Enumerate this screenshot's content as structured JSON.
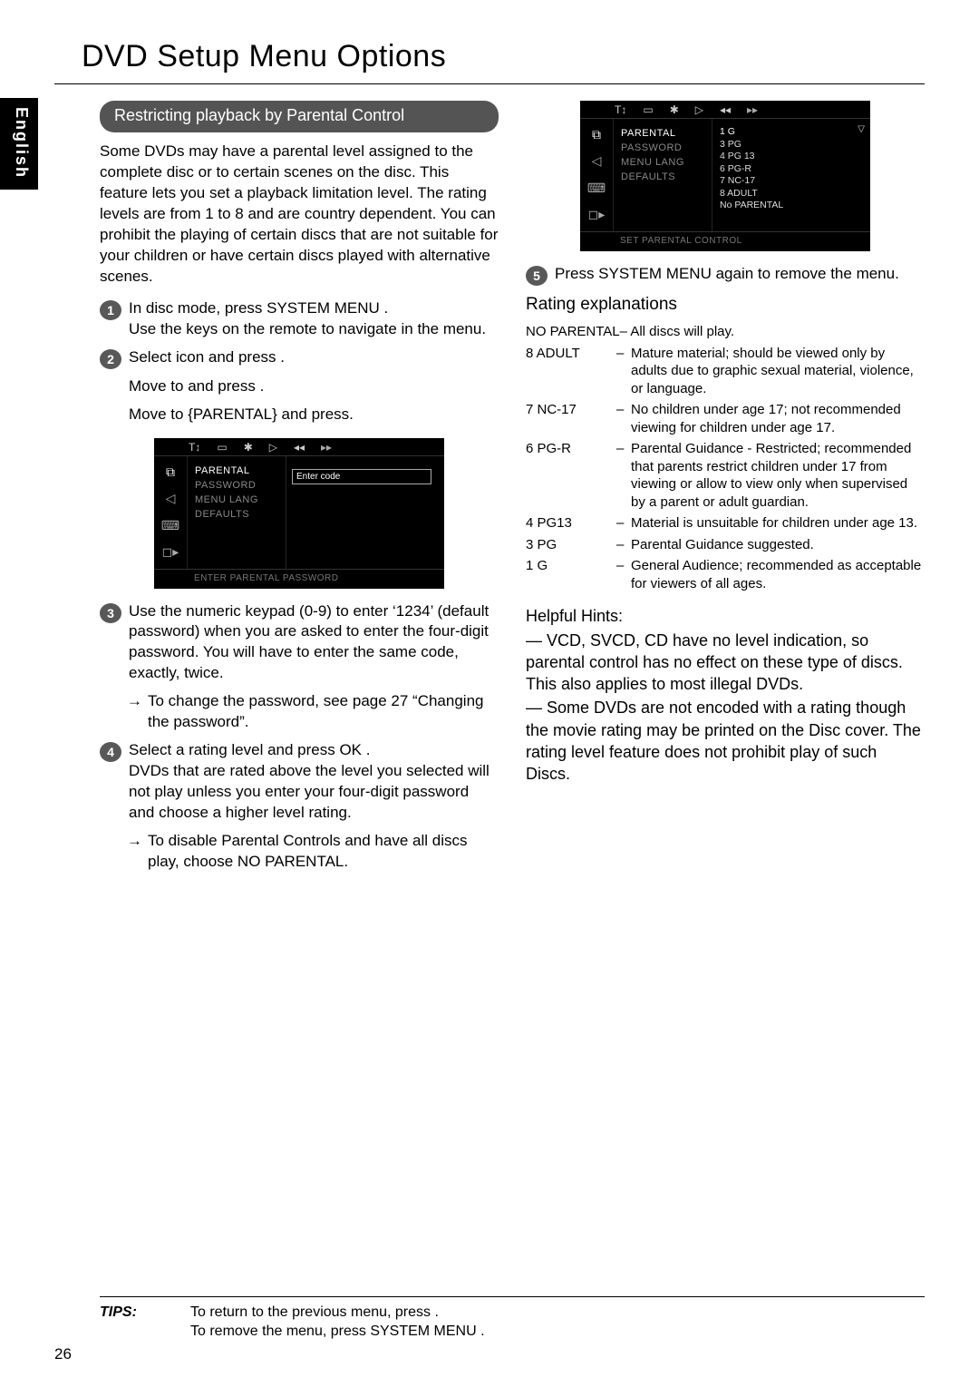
{
  "page_title": "DVD Setup Menu Options",
  "language_tab": "English",
  "section_header": "Restricting playback by Parental Control",
  "intro": "Some DVDs may have a parental level assigned to the complete disc or to certain scenes on the disc. This feature lets you set a playback limitation level. The rating levels are from 1 to 8 and are country dependent. You can prohibit the playing of certain discs that are not suitable for your children or have certain discs played with alternative scenes.",
  "steps": {
    "s1a": "In disc mode, press SYSTEM MENU .",
    "s1b": "Use the            keys on the remote to navigate in the menu.",
    "s2a": "Select     icon and press .",
    "s2b": "Move to       and press .",
    "s2c": "Move to {PARENTAL} and press.",
    "s3a": "Use the numeric keypad (0-9)  to enter ‘1234’ (default password) when you are asked to enter the four-digit password. You will have to enter the same code, exactly, twice.",
    "s3b": "To change the password, see page 27 “Changing the password”.",
    "s4a": "Select a rating level and press OK .",
    "s4b": "DVDs that are rated above the level you selected will not play unless you enter your four-digit password and choose a higher level rating.",
    "s4c": "To disable Parental Controls and have all discs play, choose NO PARENTAL.",
    "s5": "Press SYSTEM MENU  again to remove the menu."
  },
  "osd1": {
    "topbar_icons": [
      "T↕",
      "▭",
      "✱",
      "▷",
      "◂◂",
      "▸▸"
    ],
    "side_icons": [
      "⧉",
      "◁",
      "⌨",
      "◻▸"
    ],
    "menu_items": [
      "PARENTAL",
      "PASSWORD",
      "MENU LANG",
      "DEFAULTS"
    ],
    "input_label": "Enter code",
    "status": "ENTER PARENTAL PASSWORD"
  },
  "osd2": {
    "options": [
      "1 G",
      "3 PG",
      "4 PG 13",
      "6 PG-R",
      "7 NC-17",
      "8 ADULT",
      "No PARENTAL"
    ],
    "status": "SET PARENTAL CONTROL"
  },
  "rating_heading": "Rating explanations",
  "rating_top": {
    "key": "NO PARENTAL",
    "val": "– All discs will play."
  },
  "ratings": [
    {
      "key": "8 ADULT",
      "val": "Mature material; should be viewed only by adults due to graphic sexual material, violence, or language."
    },
    {
      "key": "7 NC-17",
      "val": "No children under age 17; not recommended viewing for children under age 17."
    },
    {
      "key": "6 PG-R",
      "val": "Parental Guidance - Restricted; recommended that parents restrict children under 17 from viewing or allow to view only when supervised by a parent or adult guardian."
    },
    {
      "key": "4 PG13",
      "val": "Material is unsuitable for children under age 13."
    },
    {
      "key": "3 PG",
      "val": "Parental Guidance suggested."
    },
    {
      "key": "1 G",
      "val": "General Audience; recommended as acceptable for viewers of all ages."
    }
  ],
  "hints_heading": "Helpful Hints:",
  "hints": [
    "— VCD, SVCD, CD have no level indication, so parental control has no effect on these type of discs. This also applies to most illegal DVDs.",
    "— Some DVDs are not encoded with a rating though the movie rating may be printed on the Disc cover. The rating level feature does not prohibit play of such Discs."
  ],
  "tips_label": "TIPS:",
  "tips_text_1": "To return to the previous menu, press .",
  "tips_text_2": "To remove the menu, press SYSTEM MENU .",
  "page_number": "26"
}
